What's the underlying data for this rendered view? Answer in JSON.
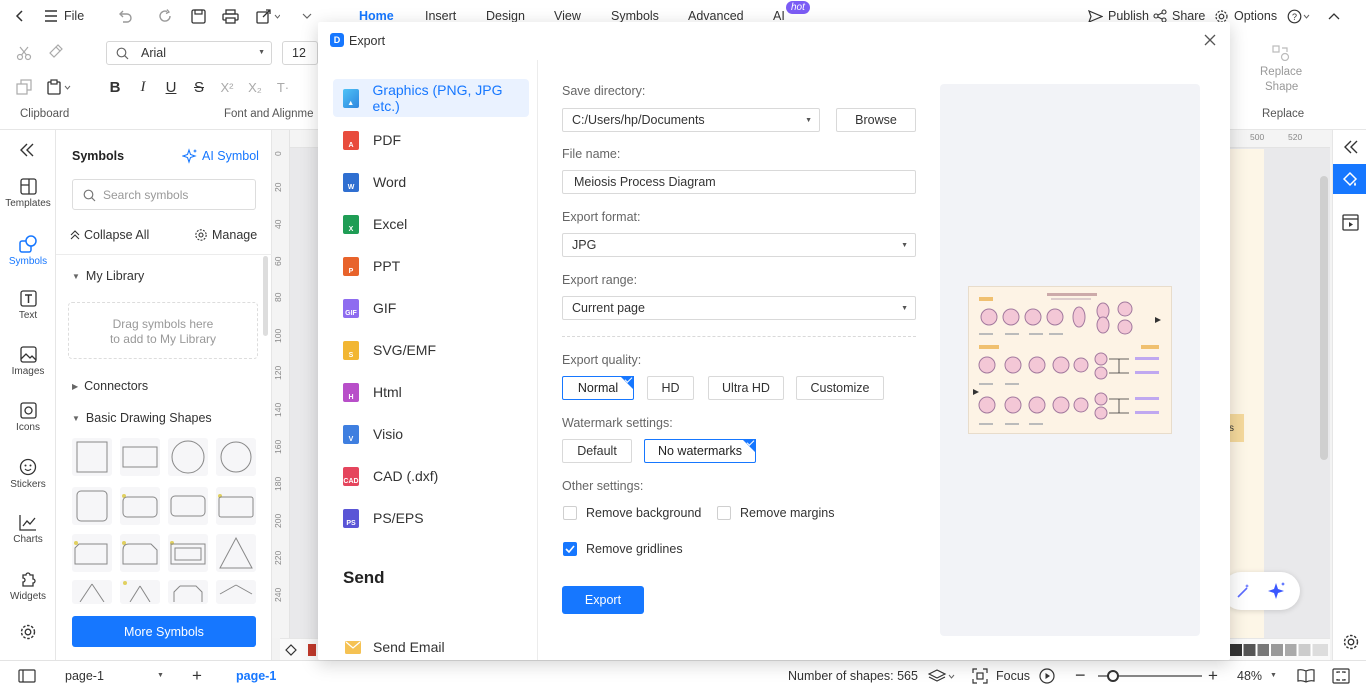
{
  "menubar": {
    "file": "File",
    "tabs": [
      "Home",
      "Insert",
      "Design",
      "View",
      "Symbols",
      "Advanced",
      "AI"
    ],
    "hot_badge": "hot",
    "publish": "Publish",
    "share": "Share",
    "options": "Options"
  },
  "ribbon": {
    "clipboard_label": "Clipboard",
    "font_label": "Font and Alignme",
    "font_name": "Arial",
    "font_size": "12",
    "replace_shape": "Replace",
    "replace_shape2": "Shape",
    "replace_label": "Replace"
  },
  "rail": {
    "items": [
      "Templates",
      "Symbols",
      "Text",
      "Images",
      "Icons",
      "Stickers",
      "Charts",
      "Widgets"
    ]
  },
  "symbols": {
    "title": "Symbols",
    "ai_symbol": "AI Symbol",
    "search_placeholder": "Search symbols",
    "collapse_all": "Collapse All",
    "manage": "Manage",
    "my_library": "My Library",
    "drop_line1": "Drag symbols here",
    "drop_line2": "to add to My Library",
    "connectors": "Connectors",
    "basic_shapes": "Basic Drawing Shapes",
    "more_symbols": "More Symbols"
  },
  "rulers": {
    "h": [
      "500",
      "520"
    ],
    "v": [
      "0",
      "20",
      "40",
      "60",
      "80",
      "100",
      "120",
      "140",
      "160",
      "180",
      "200",
      "220",
      "240"
    ]
  },
  "dialog": {
    "title": "Export",
    "formats": [
      "Graphics (PNG, JPG etc.)",
      "PDF",
      "Word",
      "Excel",
      "PPT",
      "GIF",
      "SVG/EMF",
      "Html",
      "Visio",
      "CAD (.dxf)",
      "PS/EPS"
    ],
    "send_heading": "Send",
    "send_email": "Send Email",
    "save_directory_label": "Save directory:",
    "save_directory": "C:/Users/hp/Documents",
    "browse": "Browse",
    "file_name_label": "File name:",
    "file_name": "Meiosis Process Diagram",
    "export_format_label": "Export format:",
    "export_format": "JPG",
    "export_range_label": "Export range:",
    "export_range": "Current page",
    "export_quality_label": "Export quality:",
    "quality_options": [
      "Normal",
      "HD",
      "Ultra HD",
      "Customize"
    ],
    "quality_selected": "Normal",
    "watermark_label": "Watermark settings:",
    "watermark_options": [
      "Default",
      "No watermarks"
    ],
    "watermark_selected": "No watermarks",
    "other_settings_label": "Other settings:",
    "remove_background": "Remove background",
    "remove_margins": "Remove margins",
    "remove_gridlines": "Remove gridlines",
    "remove_background_checked": false,
    "remove_margins_checked": false,
    "remove_gridlines_checked": true,
    "export_button": "Export"
  },
  "statusbar": {
    "page_select": "page-1",
    "page_tab": "page-1",
    "shape_count": "Number of shapes: 565",
    "focus": "Focus",
    "zoom": "48%"
  },
  "colors": {
    "accent": "#1677ff",
    "hot": "#7b5cf5"
  }
}
